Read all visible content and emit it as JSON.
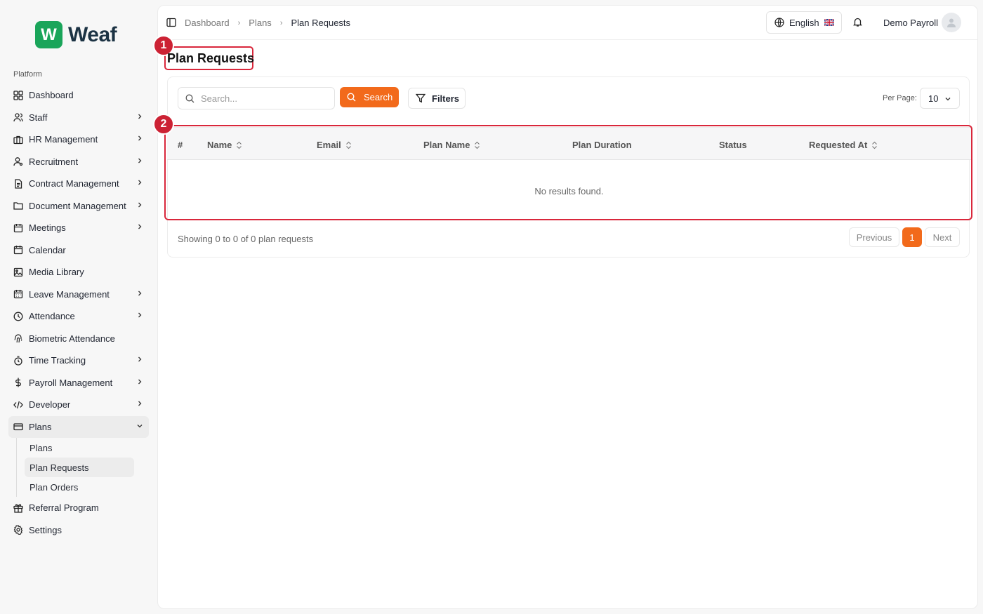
{
  "brand": {
    "logo_letter": "W",
    "name": "Weaf",
    "color": "#1aa55a"
  },
  "sidebar": {
    "section_label": "Platform",
    "items": [
      {
        "label": "Dashboard",
        "icon": "grid-icon",
        "has_children": false
      },
      {
        "label": "Staff",
        "icon": "users-icon",
        "has_children": true
      },
      {
        "label": "HR Management",
        "icon": "briefcase-icon",
        "has_children": true
      },
      {
        "label": "Recruitment",
        "icon": "user-search-icon",
        "has_children": true
      },
      {
        "label": "Contract Management",
        "icon": "file-text-icon",
        "has_children": true
      },
      {
        "label": "Document Management",
        "icon": "folder-icon",
        "has_children": true
      },
      {
        "label": "Meetings",
        "icon": "calendar-days-icon",
        "has_children": true
      },
      {
        "label": "Calendar",
        "icon": "calendar-icon",
        "has_children": false
      },
      {
        "label": "Media Library",
        "icon": "image-icon",
        "has_children": false
      },
      {
        "label": "Leave Management",
        "icon": "calendar-check-icon",
        "has_children": true
      },
      {
        "label": "Attendance",
        "icon": "clock-icon",
        "has_children": true
      },
      {
        "label": "Biometric Attendance",
        "icon": "fingerprint-icon",
        "has_children": false
      },
      {
        "label": "Time Tracking",
        "icon": "timer-icon",
        "has_children": true
      },
      {
        "label": "Payroll Management",
        "icon": "dollar-icon",
        "has_children": true
      },
      {
        "label": "Developer",
        "icon": "code-icon",
        "has_children": true
      },
      {
        "label": "Plans",
        "icon": "credit-card-icon",
        "has_children": true,
        "expanded": true
      },
      {
        "label": "Referral Program",
        "icon": "gift-icon",
        "has_children": false
      },
      {
        "label": "Settings",
        "icon": "gear-icon",
        "has_children": false
      }
    ],
    "plans_sub": [
      "Plans",
      "Plan Requests",
      "Plan Orders"
    ],
    "active_sub": "Plan Requests"
  },
  "header": {
    "breadcrumb": [
      "Dashboard",
      "Plans",
      "Plan Requests"
    ],
    "language": "English",
    "user_name": "Demo Payroll"
  },
  "page": {
    "title": "Plan Requests",
    "annotations": [
      "1",
      "2"
    ]
  },
  "toolbar": {
    "search_placeholder": "Search...",
    "search_button": "Search",
    "filters_button": "Filters",
    "per_page_label": "Per Page:",
    "per_page_value": "10"
  },
  "table": {
    "columns": [
      "#",
      "Name",
      "Email",
      "Plan Name",
      "Plan Duration",
      "Status",
      "Requested At"
    ],
    "sortable": [
      false,
      true,
      true,
      true,
      false,
      false,
      true
    ],
    "empty_text": "No results found."
  },
  "pagination": {
    "summary_prefix": "Showing",
    "from": "0",
    "to_word": "to",
    "to": "0",
    "of_word": "of",
    "total": "0",
    "suffix": "plan requests",
    "previous": "Previous",
    "current_page": "1",
    "next": "Next"
  },
  "colors": {
    "accent": "#f26a1b",
    "annotation": "#d9273b"
  }
}
